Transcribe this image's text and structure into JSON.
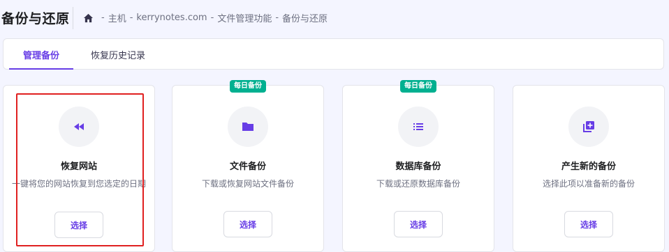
{
  "header": {
    "title": "备份与还原",
    "breadcrumb": {
      "home_icon": "home-icon",
      "items": [
        "主机",
        "kerrynotes.com",
        "文件管理功能",
        "备份与还原"
      ],
      "separator": "-"
    }
  },
  "tabs": [
    {
      "label": "管理备份",
      "active": true
    },
    {
      "label": "恢复历史记录",
      "active": false
    }
  ],
  "cards": [
    {
      "title": "恢复网站",
      "description": "一键将您的网站恢复到您选定的日期",
      "button": "选择",
      "icon": "rewind-icon",
      "badge": ""
    },
    {
      "title": "文件备份",
      "description": "下载或恢复网站文件备份",
      "button": "选择",
      "icon": "folder-icon",
      "badge": "每日备份"
    },
    {
      "title": "数据库备份",
      "description": "下载或还原数据库备份",
      "button": "选择",
      "icon": "list-icon",
      "badge": "每日备份"
    },
    {
      "title": "产生新的备份",
      "description": "选择此项以准备新的备份",
      "button": "选择",
      "icon": "add-copy-icon",
      "badge": ""
    }
  ],
  "colors": {
    "accent": "#673de6",
    "badge": "#00b090",
    "highlight": "#e02020",
    "background": "#f4f5ff"
  }
}
